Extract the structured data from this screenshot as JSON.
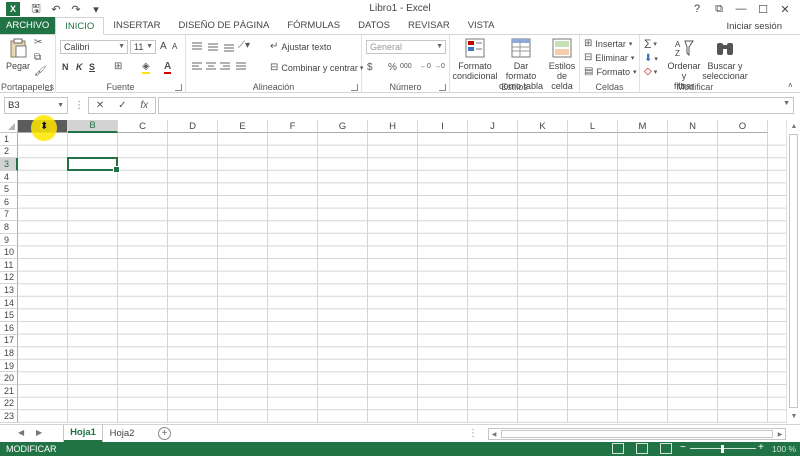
{
  "window": {
    "title": "Libro1 - Excel",
    "app_logo": "X",
    "help": "?",
    "ribbon_options": "⧉",
    "minimize": "—",
    "maximize": "☐",
    "close": "✕"
  },
  "qat": {
    "save": "🖫",
    "undo": "↶",
    "redo": "↷",
    "customize": "▾"
  },
  "tabs": [
    {
      "label": "ARCHIVO"
    },
    {
      "label": "INICIO"
    },
    {
      "label": "INSERTAR"
    },
    {
      "label": "DISEÑO DE PÁGINA"
    },
    {
      "label": "FÓRMULAS"
    },
    {
      "label": "DATOS"
    },
    {
      "label": "REVISAR"
    },
    {
      "label": "VISTA"
    }
  ],
  "signin": "Iniciar sesión",
  "ribbon": {
    "clipboard": {
      "label": "Portapapeles",
      "paste": "Pegar",
      "cut": "✂",
      "copy": "⧉",
      "format_painter": "🖌"
    },
    "font": {
      "label": "Fuente",
      "font_name": "Calibri",
      "font_size": "11",
      "grow": "A",
      "shrink": "A",
      "bold": "N",
      "italic": "K",
      "underline": "S",
      "border": "⊞",
      "fill": "◈",
      "color": "A"
    },
    "alignment": {
      "label": "Alineación",
      "wrap_text": "Ajustar texto",
      "merge_center": "Combinar y centrar"
    },
    "number": {
      "label": "Número",
      "format": "General",
      "currency": "$",
      "percent": "%",
      "comma": "000",
      "inc_decimal": "←0",
      "dec_decimal": "→0"
    },
    "styles": {
      "label": "Estilos",
      "conditional": [
        "Formato",
        "condicional"
      ],
      "table": [
        "Dar formato",
        "como tabla"
      ],
      "cell_styles": [
        "Estilos de",
        "celda"
      ]
    },
    "cells": {
      "label": "Celdas",
      "insert": "Insertar",
      "delete": "Eliminar",
      "format": "Formato"
    },
    "editing": {
      "label": "Modificar",
      "autosum": "Σ",
      "fill": "⬇",
      "clear": "◇",
      "sort": [
        "Ordenar y",
        "filtrar"
      ],
      "find": [
        "Buscar y",
        "seleccionar"
      ]
    }
  },
  "formula_bar": {
    "name_box": "B3",
    "cancel": "✕",
    "enter": "✓",
    "fx": "fx",
    "value": ""
  },
  "columns": [
    "A",
    "B",
    "C",
    "D",
    "E",
    "F",
    "G",
    "H",
    "I",
    "J",
    "K",
    "L",
    "M",
    "N",
    "O"
  ],
  "rows": [
    "1",
    "2",
    "3",
    "4",
    "5",
    "6",
    "7",
    "8",
    "9",
    "10",
    "11",
    "12",
    "13",
    "14",
    "15",
    "16",
    "17",
    "18",
    "19",
    "20",
    "21",
    "22",
    "23"
  ],
  "selection": {
    "column": "B",
    "row": "3",
    "hover_column": "A"
  },
  "sheets": [
    {
      "label": "Hoja1"
    },
    {
      "label": "Hoja2"
    }
  ],
  "add_sheet": "+",
  "status": {
    "mode": "MODIFICAR",
    "zoom_minus": "−",
    "zoom_plus": "+",
    "zoom": "100 %"
  },
  "colors": {
    "accent": "#217346",
    "highlight": "#ffe600"
  }
}
